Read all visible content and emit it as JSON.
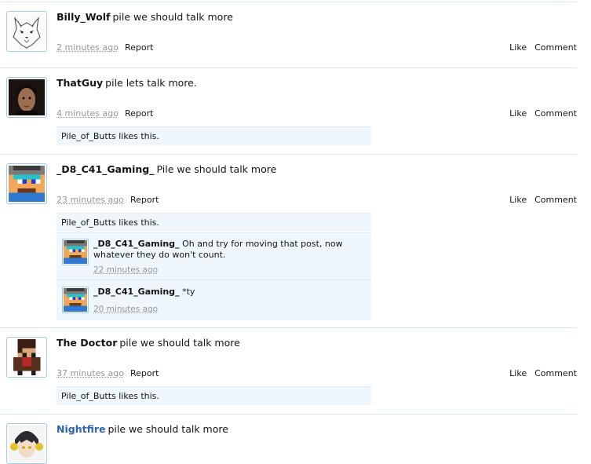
{
  "posts": [
    {
      "username": "Billy_Wolf",
      "message": "pile we should talk more",
      "time": "2 minutes ago",
      "report": "Report",
      "like": "Like",
      "comment": "Comment"
    },
    {
      "username": "ThatGuy",
      "message": "pile lets talk more.",
      "time": "4 minutes ago",
      "report": "Report",
      "like": "Like",
      "comment": "Comment",
      "likes": "Pile_of_Butts likes this."
    },
    {
      "username": "_D8_C41_Gaming_",
      "message": "Pile we should talk more",
      "time": "23 minutes ago",
      "report": "Report",
      "like": "Like",
      "comment": "Comment",
      "likes": "Pile_of_Butts likes this.",
      "comments": [
        {
          "username": "_D8_C41_Gaming_",
          "text": "Oh and try for moving that post, now whatever they do won't count.",
          "time": "22 minutes ago"
        },
        {
          "username": "_D8_C41_Gaming_",
          "text": "*ty",
          "time": "20 minutes ago"
        }
      ]
    },
    {
      "username": "The Doctor",
      "message": "pile we should talk more",
      "time": "37 minutes ago",
      "report": "Report",
      "like": "Like",
      "comment": "Comment",
      "likes": "Pile_of_Butts likes this."
    },
    {
      "username": "Nightfire",
      "message": "pile we should talk more",
      "colors": {
        "username": "#2b64b5"
      }
    }
  ],
  "colors": {
    "link_blue": "#2b64b5",
    "muted": "#969696",
    "panel": "#f0f7fc",
    "border": "#d7e5f3"
  },
  "icons": {
    "avatar_1": "wolf-sketch-avatar",
    "avatar_2": "man-portrait-avatar",
    "avatar_3": "pixel-gamer-avatar",
    "avatar_4": "pixel-doctor-avatar",
    "avatar_5": "anime-headphones-avatar"
  }
}
